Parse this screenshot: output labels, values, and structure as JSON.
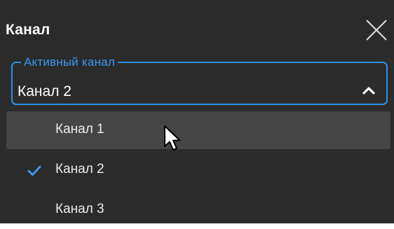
{
  "dialog": {
    "title": "Канал",
    "close_icon": "close-icon"
  },
  "channel_select": {
    "legend": "Активный канал",
    "value": "Канал 2",
    "expanded": true,
    "chevron_icon": "chevron-up-icon",
    "accent_color": "#2f8fe6"
  },
  "dropdown": {
    "options": [
      {
        "label": "Канал 1",
        "hovered": true,
        "selected": false
      },
      {
        "label": "Канал 2",
        "hovered": false,
        "selected": true
      },
      {
        "label": "Канал 3",
        "hovered": false,
        "selected": false
      }
    ],
    "check_icon": "checkmark-icon",
    "hover_color": "#454545"
  },
  "colors": {
    "background": "#2b2b2b",
    "text": "#ffffff",
    "accent": "#2f8fe6"
  }
}
